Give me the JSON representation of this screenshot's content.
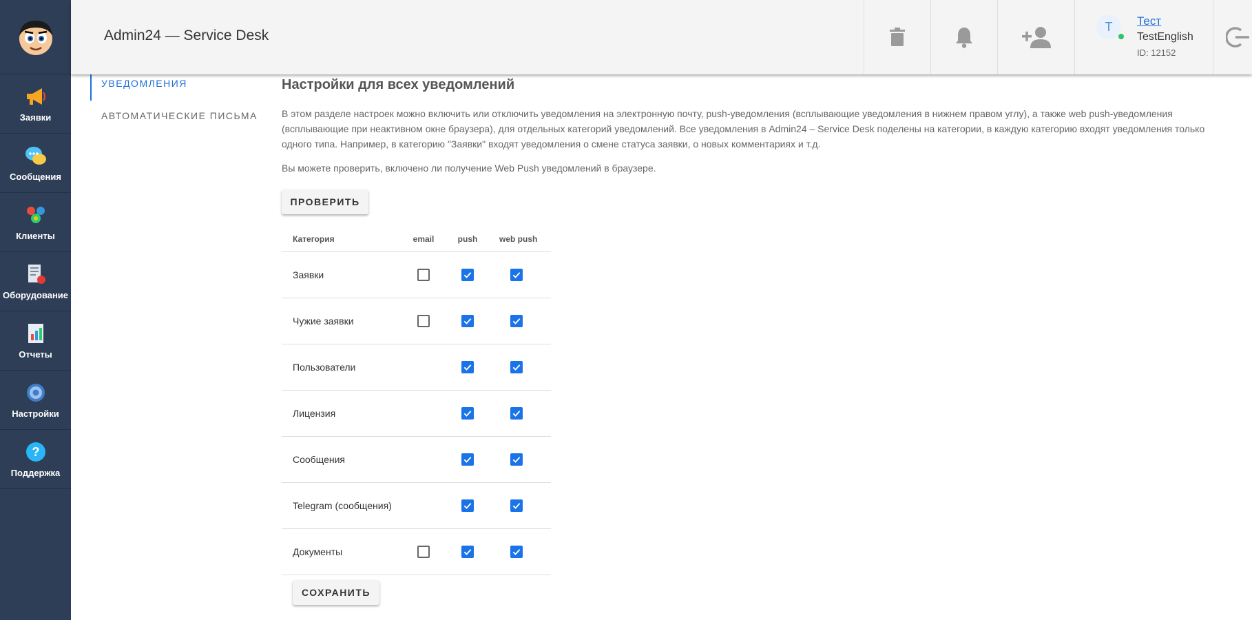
{
  "header": {
    "title": "Admin24 — Service Desk",
    "icons": [
      "trash-icon",
      "bell-icon",
      "add-user-icon",
      "logout-icon"
    ]
  },
  "user": {
    "avatar_letter": "T",
    "name": "Тест",
    "login": "TestEnglish",
    "id_label": "ID: 12152",
    "status_color": "#2ec46b"
  },
  "sidebar": {
    "items": [
      {
        "label": "Заявки",
        "icon": "megaphone-icon"
      },
      {
        "label": "Сообщения",
        "icon": "chat-icon"
      },
      {
        "label": "Клиенты",
        "icon": "clients-icon"
      },
      {
        "label": "Оборудование",
        "icon": "equipment-icon"
      },
      {
        "label": "Отчеты",
        "icon": "reports-icon"
      },
      {
        "label": "Настройки",
        "icon": "gear-icon"
      },
      {
        "label": "Поддержка",
        "icon": "help-icon"
      }
    ]
  },
  "submenu": {
    "items": [
      "УВЕДОМЛЕНИЯ",
      "АВТОМАТИЧЕСКИЕ ПИСЬМА"
    ],
    "active": "УВЕДОМЛЕНИЯ"
  },
  "main": {
    "title": "Настройки для всех уведомлений",
    "description": "В этом разделе настроек можно включить или отключить уведомления на электронную почту, push-уведомления (всплывающие уведомления в нижнем правом углу), а также web push-уведомления (всплывающие при неактивном окне браузера), для отдельных категорий уведомлений. Все уведомления в Admin24 – Service Desk поделены на категории, в каждую категорию входят уведомления только одного типа. Например, в категорию \"Заявки\" входят уведомления о смене статуса заявки, о новых комментариях и т.д.",
    "check_text": "Вы можете проверить, включено ли получение Web Push уведомлений в браузере.",
    "check_button": "ПРОВЕРИТЬ",
    "save_button": "СОХРАНИТЬ"
  },
  "table": {
    "headers": {
      "category": "Категория",
      "email": "email",
      "push": "push",
      "web_push": "web push"
    },
    "rows": [
      {
        "category": "Заявки",
        "email": false,
        "push": true,
        "web_push": true
      },
      {
        "category": "Чужие заявки",
        "email": false,
        "push": true,
        "web_push": true
      },
      {
        "category": "Пользователи",
        "email": null,
        "push": true,
        "web_push": true
      },
      {
        "category": "Лицензия",
        "email": null,
        "push": true,
        "web_push": true
      },
      {
        "category": "Сообщения",
        "email": null,
        "push": true,
        "web_push": true
      },
      {
        "category": "Telegram (сообщения)",
        "email": null,
        "push": true,
        "web_push": true
      },
      {
        "category": "Документы",
        "email": false,
        "push": true,
        "web_push": true
      }
    ]
  },
  "colors": {
    "sidebar": "#2e3e56",
    "accent": "#1e6fd9",
    "checkbox": "#1a73e8"
  }
}
